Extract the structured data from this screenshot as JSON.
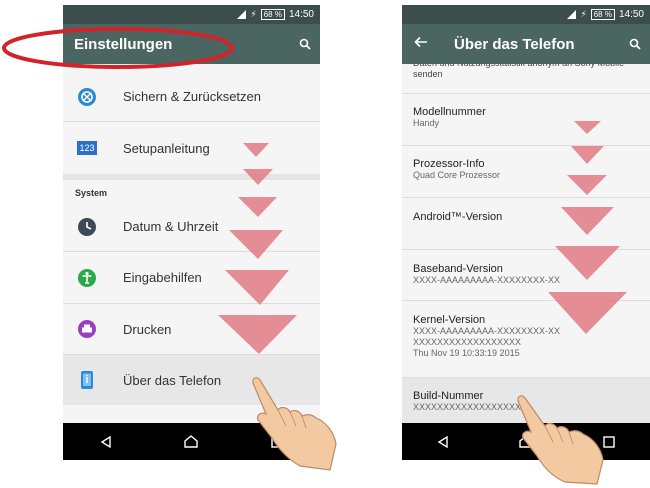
{
  "status": {
    "time": "14:50",
    "battery": "68 %"
  },
  "left": {
    "title": "Einstellungen",
    "items_top": [
      {
        "label": "Sichern & Zurücksetzen",
        "icon": "backup-icon"
      },
      {
        "label": "Setupanleitung",
        "icon": "setup-guide-icon",
        "icon_text": "123"
      }
    ],
    "section_label": "System",
    "items_system": [
      {
        "label": "Datum & Uhrzeit",
        "icon": "clock-icon"
      },
      {
        "label": "Eingabehilfen",
        "icon": "accessibility-icon"
      },
      {
        "label": "Drucken",
        "icon": "printer-icon"
      },
      {
        "label": "Über das Telefon",
        "icon": "phone-info-icon"
      }
    ]
  },
  "right": {
    "title": "Über das Telefon",
    "top_partial": "Daten und Nutzungsstatistik anonym an Sony Mobile senden",
    "items": [
      {
        "title": "Modellnummer",
        "sub": "Handy"
      },
      {
        "title": "Prozessor-Info",
        "sub": "Quad Core Prozessor"
      },
      {
        "title": "Android™-Version",
        "sub": ""
      },
      {
        "title": "Baseband-Version",
        "sub": "XXXX-AAAAAAAAA-XXXXXXXX-XX"
      },
      {
        "title": "Kernel-Version",
        "sub": "XXXX-AAAAAAAAA-XXXXXXXX-XX",
        "sub2": "XXXXXXXXXXXXXXXXXX",
        "sub3": "Thu Nov 19 10:33:19 2015"
      },
      {
        "title": "Build-Nummer",
        "sub": "XXXXXXXXXXXXXXXXXX"
      }
    ]
  },
  "colors": {
    "appbar": "#4b6561",
    "statusbar": "#3b4e4c",
    "arrow": "#e07a82",
    "oval": "#d2232a",
    "highlight": "#e7e7e7"
  }
}
